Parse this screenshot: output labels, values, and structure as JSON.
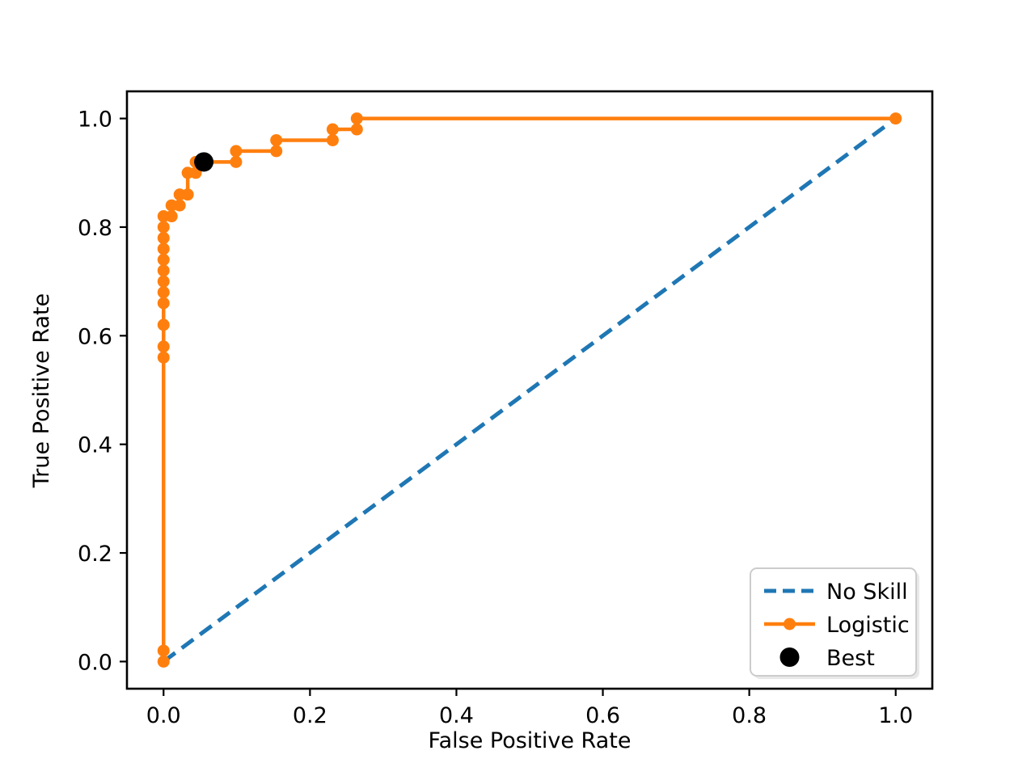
{
  "chart_data": {
    "type": "line",
    "title": "",
    "xlabel": "False Positive Rate",
    "ylabel": "True Positive Rate",
    "xlim": [
      -0.05,
      1.05
    ],
    "ylim": [
      -0.05,
      1.05
    ],
    "grid": false,
    "legend_position": "lower right",
    "xticks": [
      "0.0",
      "0.2",
      "0.4",
      "0.6",
      "0.8",
      "1.0"
    ],
    "xtick_values": [
      0.0,
      0.2,
      0.4,
      0.6,
      0.8,
      1.0
    ],
    "yticks": [
      "0.0",
      "0.2",
      "0.4",
      "0.6",
      "0.8",
      "1.0"
    ],
    "ytick_values": [
      0.0,
      0.2,
      0.4,
      0.6,
      0.8,
      1.0
    ],
    "series": [
      {
        "name": "No Skill",
        "type": "line",
        "style": "dashed",
        "color": "#1f77b4",
        "marker": "none",
        "x": [
          0.0,
          1.0
        ],
        "y": [
          0.0,
          1.0
        ]
      },
      {
        "name": "Logistic",
        "type": "line",
        "style": "solid",
        "color": "#ff7f0e",
        "marker": "circle",
        "x": [
          0.0,
          0.0,
          0.0,
          0.0,
          0.0,
          0.0,
          0.0,
          0.0,
          0.0,
          0.0,
          0.0,
          0.0,
          0.0,
          0.0,
          0.011,
          0.011,
          0.022,
          0.022,
          0.033,
          0.033,
          0.044,
          0.044,
          0.055,
          0.055,
          0.099,
          0.099,
          0.154,
          0.154,
          0.231,
          0.231,
          0.264,
          0.264,
          1.0
        ],
        "y": [
          0.0,
          0.02,
          0.56,
          0.58,
          0.62,
          0.66,
          0.68,
          0.7,
          0.72,
          0.74,
          0.76,
          0.78,
          0.8,
          0.82,
          0.82,
          0.84,
          0.84,
          0.86,
          0.86,
          0.9,
          0.9,
          0.92,
          0.92,
          0.92,
          0.92,
          0.94,
          0.94,
          0.96,
          0.96,
          0.98,
          0.98,
          1.0,
          1.0
        ]
      },
      {
        "name": "Best",
        "type": "scatter",
        "style": "marker-only",
        "color": "#000000",
        "marker": "circle",
        "x": [
          0.055
        ],
        "y": [
          0.92
        ]
      }
    ],
    "legend_entries": [
      {
        "label": "No Skill",
        "color": "#1f77b4",
        "style": "dashed"
      },
      {
        "label": "Logistic",
        "color": "#ff7f0e",
        "style": "solid-marker"
      },
      {
        "label": "Best",
        "color": "#000000",
        "style": "dot"
      }
    ]
  },
  "axes": {
    "xlabel": "False Positive Rate",
    "ylabel": "True Positive Rate"
  }
}
